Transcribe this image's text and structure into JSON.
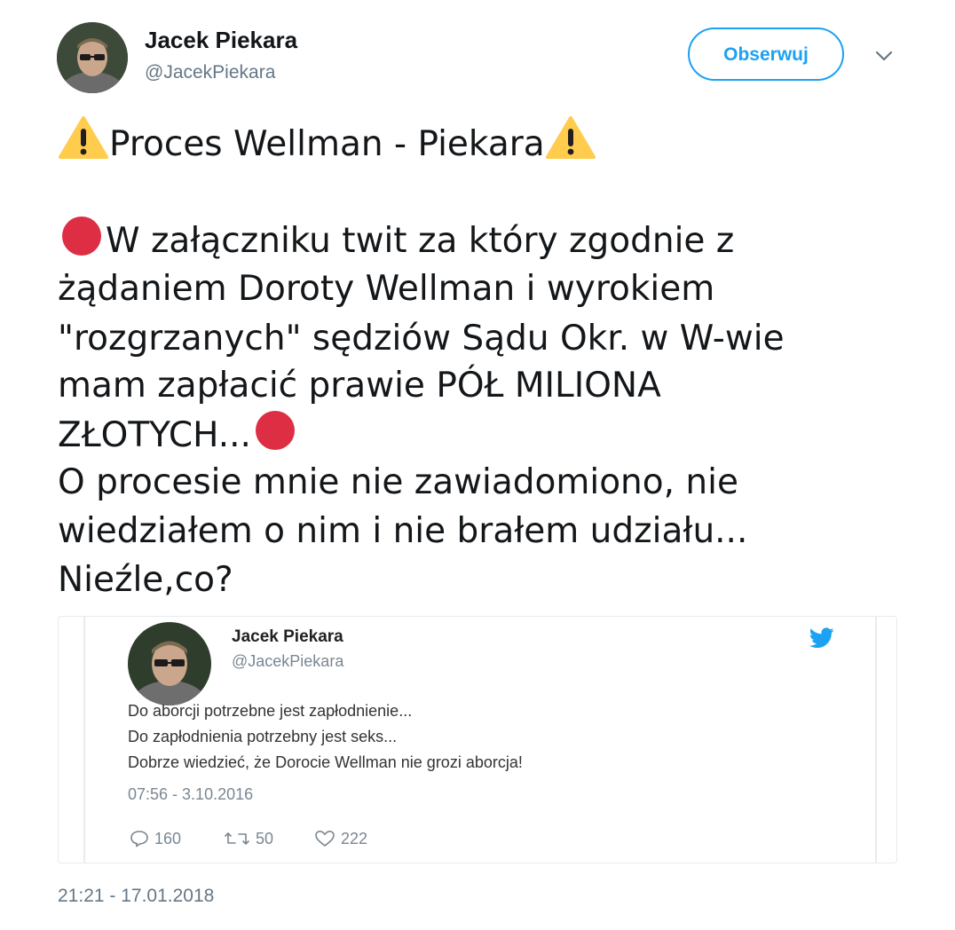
{
  "author": {
    "name": "Jacek Piekara",
    "handle": "@JacekPiekara"
  },
  "follow_button": {
    "label": "Obserwuj"
  },
  "more_menu": {
    "icon": "chevron-down-icon"
  },
  "tweet": {
    "lines": [
      "Proces Wellman - Piekara",
      "W załączniku twit za który zgodnie z",
      "żądaniem Doroty Wellman i wyrokiem",
      "\"rozgrzanych\" sędziów Sądu Okr. w W-wie",
      "mam zapłacić prawie PÓŁ MILIONA",
      "ZŁOTYCH...",
      "O procesie mnie nie zawiadomiono, nie",
      "wiedziałem o nim i nie brałem udziału...",
      "Nieźle,co?"
    ],
    "emojis": {
      "warning": "warning-icon",
      "red_circle": "red-circle-icon"
    },
    "colors": {
      "warning_fill": "#ffcc4d",
      "red_circle": "#dd2e44"
    }
  },
  "embedded_tweet": {
    "name": "Jacek Piekara",
    "handle": "@JacekPiekara",
    "lines": [
      "Do aborcji potrzebne jest zapłodnienie...",
      "Do zapłodnienia potrzebny jest seks...",
      "Dobrze wiedzieć, że Dorocie Wellman nie grozi aborcja!"
    ],
    "time": "07:56 - 3.10.2016",
    "stats": {
      "replies": "160",
      "retweets": "50",
      "likes": "222"
    },
    "bird_color": "#1da1f2"
  },
  "timestamp": "21:21 - 17.01.2018",
  "colors": {
    "accent": "#1da1f2",
    "text": "#14171a",
    "secondary": "#657786"
  }
}
